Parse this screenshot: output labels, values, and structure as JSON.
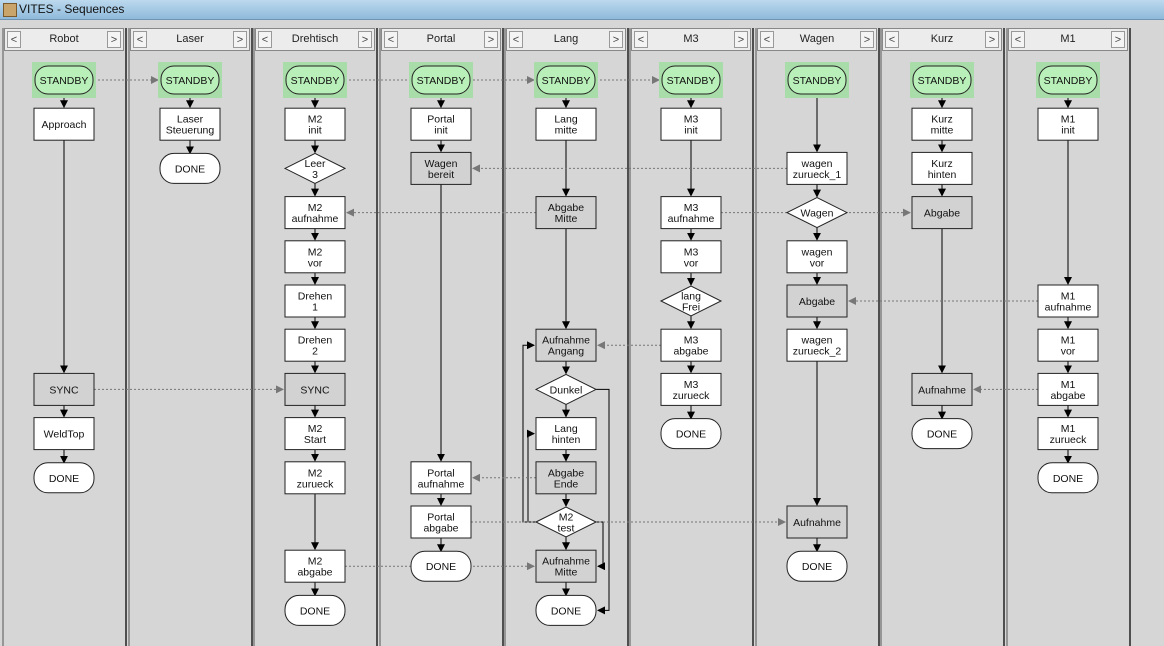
{
  "window": {
    "title": "VITES - Sequences"
  },
  "nav": {
    "prev": "<",
    "next": ">"
  },
  "colors": {
    "standby": "#b9f0b9",
    "active": "#d2d2d2",
    "idle": "#ffffff",
    "background": "#d6d6d6"
  },
  "lanes": [
    {
      "name": "Robot",
      "nodes": [
        {
          "lines": [
            "STANDBY"
          ],
          "shape": "standby"
        },
        {
          "lines": [
            "Approach"
          ],
          "shape": "box"
        },
        {
          "lines": [
            "SYNC"
          ],
          "shape": "box",
          "state": "active"
        },
        {
          "lines": [
            "WeldTop"
          ],
          "shape": "box"
        },
        {
          "lines": [
            "DONE"
          ],
          "shape": "done"
        }
      ]
    },
    {
      "name": "Laser",
      "nodes": [
        {
          "lines": [
            "STANDBY"
          ],
          "shape": "standby"
        },
        {
          "lines": [
            "Laser",
            "Steuerung"
          ],
          "shape": "box"
        },
        {
          "lines": [
            "DONE"
          ],
          "shape": "done"
        }
      ]
    },
    {
      "name": "Drehtisch",
      "nodes": [
        {
          "lines": [
            "STANDBY"
          ],
          "shape": "standby"
        },
        {
          "lines": [
            "M2",
            "init"
          ],
          "shape": "box"
        },
        {
          "lines": [
            "Leer",
            "3"
          ],
          "shape": "diamond"
        },
        {
          "lines": [
            "M2",
            "aufnahme"
          ],
          "shape": "box"
        },
        {
          "lines": [
            "M2",
            "vor"
          ],
          "shape": "box"
        },
        {
          "lines": [
            "Drehen",
            "1"
          ],
          "shape": "box"
        },
        {
          "lines": [
            "Drehen",
            "2"
          ],
          "shape": "box"
        },
        {
          "lines": [
            "SYNC"
          ],
          "shape": "box",
          "state": "active"
        },
        {
          "lines": [
            "M2",
            "Start"
          ],
          "shape": "box"
        },
        {
          "lines": [
            "M2",
            "zurueck"
          ],
          "shape": "box"
        },
        {
          "lines": [
            "M2",
            "abgabe"
          ],
          "shape": "box"
        },
        {
          "lines": [
            "DONE"
          ],
          "shape": "done"
        }
      ]
    },
    {
      "name": "Portal",
      "nodes": [
        {
          "lines": [
            "STANDBY"
          ],
          "shape": "standby"
        },
        {
          "lines": [
            "Portal",
            "init"
          ],
          "shape": "box"
        },
        {
          "lines": [
            "Wagen",
            "bereit"
          ],
          "shape": "box",
          "state": "active"
        },
        {
          "lines": [
            "Portal",
            "aufnahme"
          ],
          "shape": "box"
        },
        {
          "lines": [
            "Portal",
            "abgabe"
          ],
          "shape": "box"
        },
        {
          "lines": [
            "DONE"
          ],
          "shape": "done"
        }
      ]
    },
    {
      "name": "Lang",
      "nodes": [
        {
          "lines": [
            "STANDBY"
          ],
          "shape": "standby"
        },
        {
          "lines": [
            "Lang",
            "mitte"
          ],
          "shape": "box"
        },
        {
          "lines": [
            "Abgabe",
            "Mitte"
          ],
          "shape": "box",
          "state": "active"
        },
        {
          "lines": [
            "Aufnahme",
            "Angang"
          ],
          "shape": "box",
          "state": "active"
        },
        {
          "lines": [
            "Dunkel"
          ],
          "shape": "diamond"
        },
        {
          "lines": [
            "Lang",
            "hinten"
          ],
          "shape": "box"
        },
        {
          "lines": [
            "Abgabe",
            "Ende"
          ],
          "shape": "box",
          "state": "active"
        },
        {
          "lines": [
            "M2",
            "test"
          ],
          "shape": "diamond"
        },
        {
          "lines": [
            "Aufnahme",
            "Mitte"
          ],
          "shape": "box",
          "state": "active"
        },
        {
          "lines": [
            "DONE"
          ],
          "shape": "done"
        }
      ]
    },
    {
      "name": "M3",
      "nodes": [
        {
          "lines": [
            "STANDBY"
          ],
          "shape": "standby"
        },
        {
          "lines": [
            "M3",
            "init"
          ],
          "shape": "box"
        },
        {
          "lines": [
            "M3",
            "aufnahme"
          ],
          "shape": "box"
        },
        {
          "lines": [
            "M3",
            "vor"
          ],
          "shape": "box"
        },
        {
          "lines": [
            "lang",
            "Frei"
          ],
          "shape": "diamond"
        },
        {
          "lines": [
            "M3",
            "abgabe"
          ],
          "shape": "box"
        },
        {
          "lines": [
            "M3",
            "zurueck"
          ],
          "shape": "box"
        },
        {
          "lines": [
            "DONE"
          ],
          "shape": "done"
        }
      ]
    },
    {
      "name": "Wagen",
      "nodes": [
        {
          "lines": [
            "STANDBY"
          ],
          "shape": "standby"
        },
        {
          "lines": [
            "wagen",
            "zurueck_1"
          ],
          "shape": "box"
        },
        {
          "lines": [
            "Wagen"
          ],
          "shape": "diamond"
        },
        {
          "lines": [
            "wagen",
            "vor"
          ],
          "shape": "box"
        },
        {
          "lines": [
            "Abgabe"
          ],
          "shape": "box",
          "state": "active"
        },
        {
          "lines": [
            "wagen",
            "zurueck_2"
          ],
          "shape": "box"
        },
        {
          "lines": [
            "Aufnahme"
          ],
          "shape": "box",
          "state": "active"
        },
        {
          "lines": [
            "DONE"
          ],
          "shape": "done"
        }
      ]
    },
    {
      "name": "Kurz",
      "nodes": [
        {
          "lines": [
            "STANDBY"
          ],
          "shape": "standby"
        },
        {
          "lines": [
            "Kurz",
            "mitte"
          ],
          "shape": "box"
        },
        {
          "lines": [
            "Kurz",
            "hinten"
          ],
          "shape": "box"
        },
        {
          "lines": [
            "Abgabe"
          ],
          "shape": "box",
          "state": "active"
        },
        {
          "lines": [
            "Aufnahme"
          ],
          "shape": "box",
          "state": "active"
        },
        {
          "lines": [
            "DONE"
          ],
          "shape": "done"
        }
      ]
    },
    {
      "name": "M1",
      "nodes": [
        {
          "lines": [
            "STANDBY"
          ],
          "shape": "standby"
        },
        {
          "lines": [
            "M1",
            "init"
          ],
          "shape": "box"
        },
        {
          "lines": [
            "M1",
            "aufnahme"
          ],
          "shape": "box"
        },
        {
          "lines": [
            "M1",
            "vor"
          ],
          "shape": "box"
        },
        {
          "lines": [
            "M1",
            "abgabe"
          ],
          "shape": "box"
        },
        {
          "lines": [
            "M1",
            "zurueck"
          ],
          "shape": "box"
        },
        {
          "lines": [
            "DONE"
          ],
          "shape": "done"
        }
      ]
    }
  ],
  "sync_links": [
    {
      "from": [
        0,
        0
      ],
      "to": [
        1,
        0
      ]
    },
    {
      "from": [
        2,
        0
      ],
      "to": [
        4,
        0
      ]
    },
    {
      "from": [
        4,
        0
      ],
      "to": [
        5,
        0
      ]
    },
    {
      "from": [
        6,
        1
      ],
      "to": [
        3,
        2
      ]
    },
    {
      "from": [
        4,
        2
      ],
      "to": [
        2,
        3
      ]
    },
    {
      "from": [
        5,
        2
      ],
      "to": [
        7,
        3
      ]
    },
    {
      "from": [
        8,
        2
      ],
      "to": [
        6,
        4
      ]
    },
    {
      "from": [
        5,
        5
      ],
      "to": [
        4,
        3
      ]
    },
    {
      "from": [
        0,
        2
      ],
      "to": [
        2,
        7
      ]
    },
    {
      "from": [
        8,
        4
      ],
      "to": [
        7,
        4
      ]
    },
    {
      "from": [
        4,
        6
      ],
      "to": [
        3,
        3
      ]
    },
    {
      "from": [
        3,
        4
      ],
      "to": [
        6,
        6
      ]
    },
    {
      "from": [
        2,
        10
      ],
      "to": [
        4,
        8
      ]
    }
  ]
}
